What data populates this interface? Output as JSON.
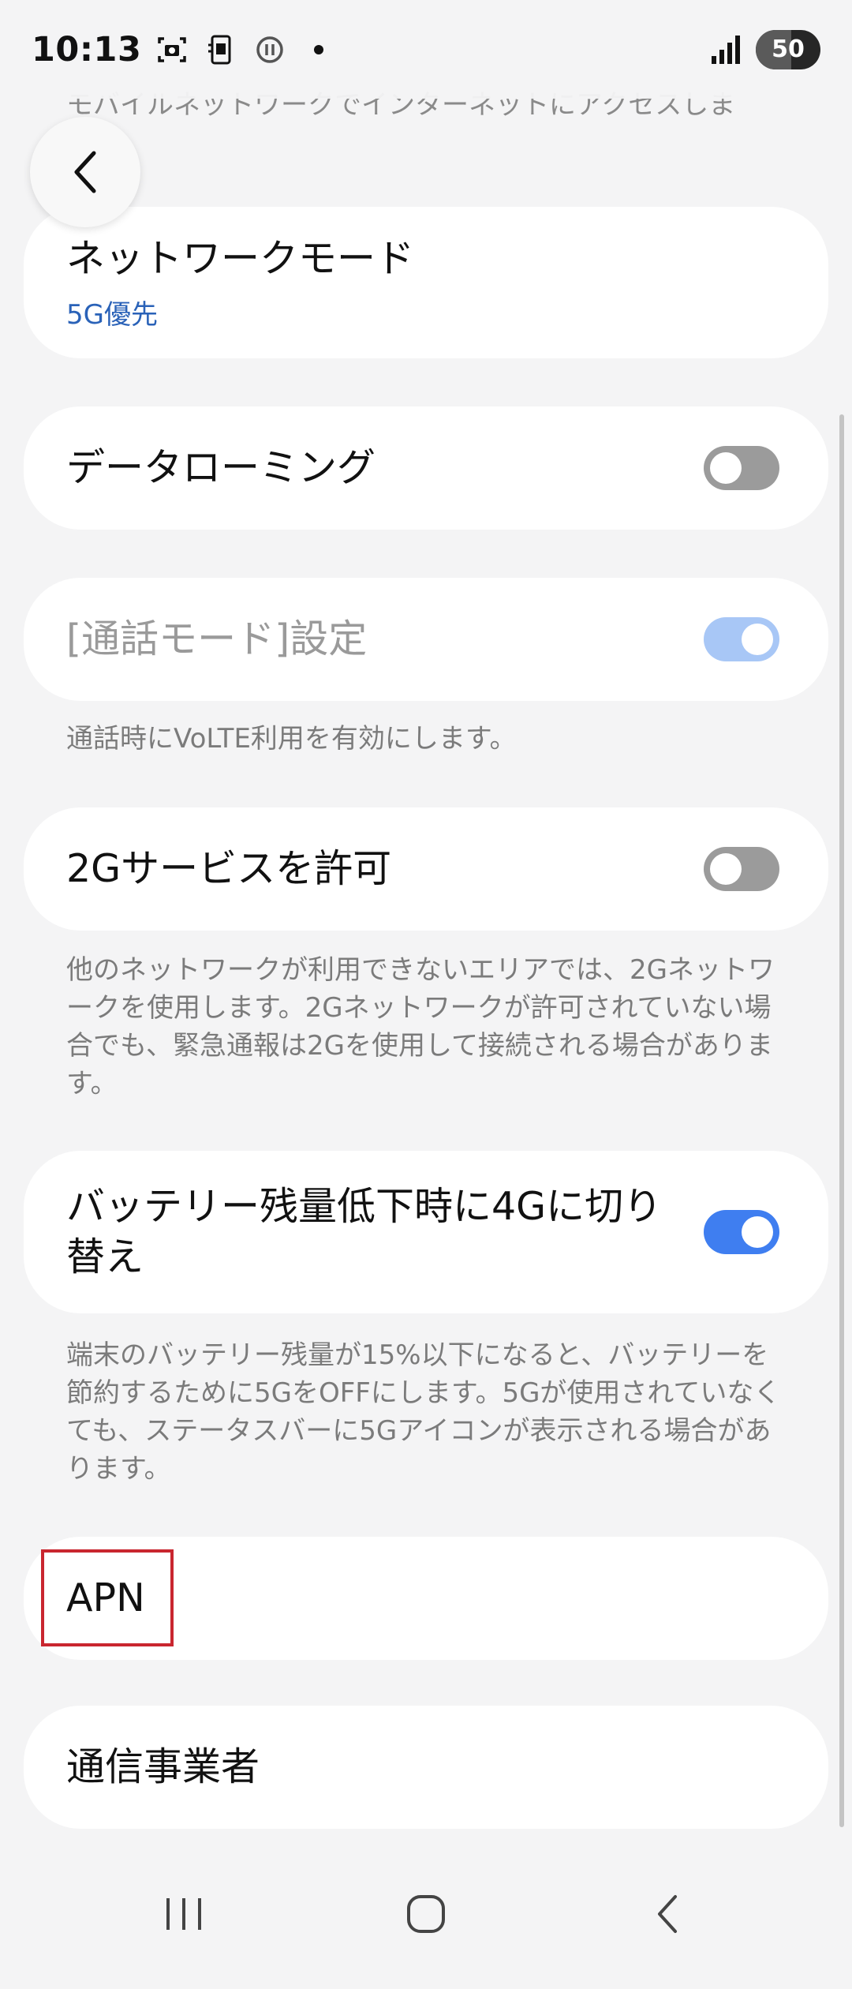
{
  "status_bar": {
    "time": "10:13",
    "battery_level": "50",
    "icons": [
      "screenshot-icon",
      "sim-icon",
      "info-icon",
      "notification-dot-icon",
      "signal-icon",
      "battery-icon"
    ]
  },
  "header": {
    "partial_description": "モバイルネットワークでインターネットにアクセスしま"
  },
  "settings": {
    "network_mode": {
      "title": "ネットワークモード",
      "value": "5G優先"
    },
    "data_roaming": {
      "title": "データローミング",
      "enabled": false
    },
    "call_mode": {
      "title": "[通話モード]設定",
      "enabled": true,
      "disabled_state": true,
      "description": "通話時にVoLTE利用を有効にします。"
    },
    "allow_2g": {
      "title": "2Gサービスを許可",
      "enabled": false,
      "description": "他のネットワークが利用できないエリアでは、2Gネットワークを使用します。2Gネットワークが許可されていない場合でも、緊急通報は2Gを使用して接続される場合があります。"
    },
    "battery_4g": {
      "title": "バッテリー残量低下時に4Gに切り替え",
      "enabled": true,
      "description": "端末のバッテリー残量が15%以下になると、バッテリーを節約するために5GをOFFにします。5Gが使用されていなくても、ステータスバーに5Gアイコンが表示される場合があります。"
    },
    "apn": {
      "title": "APN"
    },
    "carrier": {
      "title": "通信事業者"
    }
  },
  "colors": {
    "accent": "#3f7ef0",
    "highlight": "#c9262f",
    "link": "#2a62b8",
    "background": "#f4f4f5"
  }
}
